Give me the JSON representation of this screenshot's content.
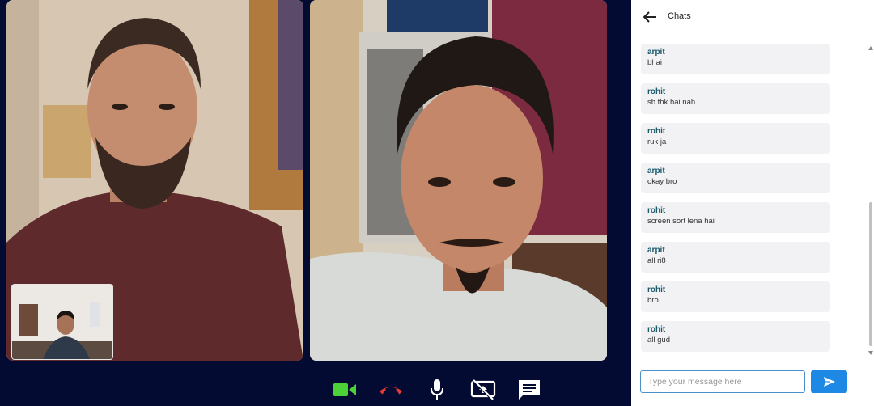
{
  "chat": {
    "title": "Chats",
    "messages": [
      {
        "sender": "arpit",
        "text": "bhai"
      },
      {
        "sender": "rohit",
        "text": "sb thk hai nah"
      },
      {
        "sender": "rohit",
        "text": "ruk ja"
      },
      {
        "sender": "arpit",
        "text": "okay bro"
      },
      {
        "sender": "rohit",
        "text": "screen sort lena hai"
      },
      {
        "sender": "arpit",
        "text": "all ri8"
      },
      {
        "sender": "rohit",
        "text": "bro"
      },
      {
        "sender": "rohit",
        "text": "all gud"
      }
    ],
    "input_placeholder": "Type your message here",
    "input_value": ""
  },
  "controls": {
    "icons": [
      "video-camera-icon",
      "end-call-icon",
      "microphone-icon",
      "screen-share-off-icon",
      "chat-icon"
    ],
    "colors": {
      "camera": "#4cd137",
      "end_call": "#e53935",
      "default": "#ffffff",
      "send": "#1e88e5",
      "sender_name": "#1b5a6b",
      "background": "#030b33"
    }
  }
}
